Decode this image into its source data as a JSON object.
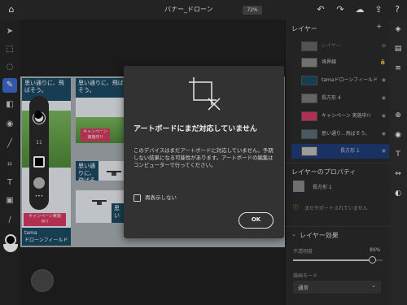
{
  "header": {
    "doc_title": "バナー_ドローン",
    "zoom": "72%",
    "icons": [
      "home-icon",
      "undo-icon",
      "redo-icon",
      "cloud-icon",
      "share-icon",
      "help-icon"
    ]
  },
  "toolbar": {
    "tools": [
      "select-tool",
      "direct-select-tool",
      "lasso-tool",
      "brush-tool",
      "eraser-tool",
      "fill-tool",
      "eyedropper-tool",
      "crop-tool",
      "text-tool",
      "image-tool",
      "color-picker-tool"
    ]
  },
  "color_pill": {
    "number": "11",
    "more": "•••"
  },
  "artboards": {
    "headline_1": "思い通りに、飛ばそう。",
    "headline_2": "思い通りに、飛ばそう。",
    "headline_3": "思い通りに、飛ばそう。",
    "headline_4": "思い",
    "campaign_1": "キャンペーン実施中!!",
    "campaign_2": "キャンペーン実施中!!",
    "tama_line1": "tama",
    "tama_line2": "ドローンフィールド"
  },
  "layers_panel": {
    "title": "レイヤー",
    "layers": [
      {
        "name": "レイヤー",
        "vis": "⊘"
      },
      {
        "name": "境界線",
        "vis": "🔒"
      },
      {
        "name": "tamaドローンフィールド",
        "vis": "◉"
      },
      {
        "name": "長方形 4",
        "vis": "◉"
      },
      {
        "name": "キャンペーン 実施中!!",
        "vis": "◉"
      },
      {
        "name": "思い通り...飛ばそう。",
        "vis": "◉"
      },
      {
        "name": "長方形 1",
        "vis": "◉"
      }
    ]
  },
  "properties": {
    "title": "レイヤーのプロパティ",
    "layer_name": "長方形 1",
    "warning": "まだサポートされていません"
  },
  "effects": {
    "title": "レイヤー効果",
    "opacity_label": "不透明度",
    "opacity_value": "89%",
    "blend_label": "描画モード",
    "blend_value": "通常"
  },
  "modal": {
    "title": "アートボードにまだ対応していません",
    "body": "このデバイスはまだアートボードに対応していません。予期しない結果になる可能性があります。アートボードの編集はコンピューターで行ってください。",
    "checkbox_label": "再表示しない",
    "ok_label": "OK"
  },
  "colors": {
    "accent": "#3f6bd1",
    "selected_layer": "#1e3d7a",
    "campaign_pink": "#d83b63",
    "banner_blue": "#1d4b64"
  }
}
